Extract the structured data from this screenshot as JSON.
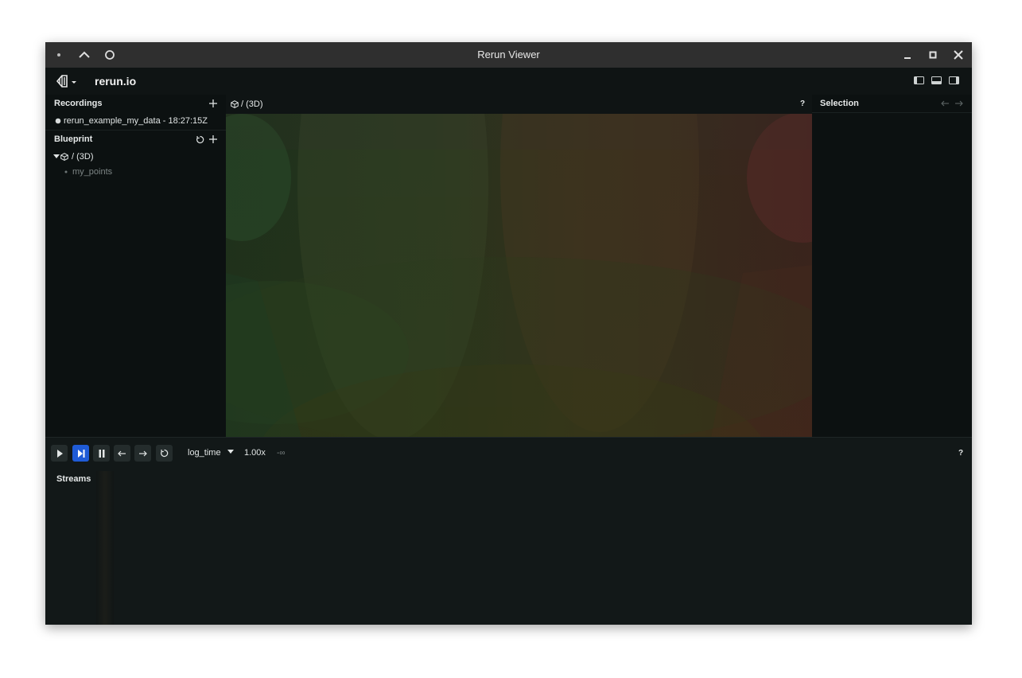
{
  "window": {
    "title": "Rerun Viewer",
    "controls": [
      "minimize-icon",
      "maximize-icon",
      "close-icon"
    ],
    "left_controls": [
      "dot-icon",
      "chevron-up-icon",
      "circle-icon"
    ]
  },
  "appbar": {
    "brand": "rerun.io",
    "logo_icon": "rerun-logo-icon",
    "layout_buttons": [
      "toggle-left-panel-icon",
      "toggle-bottom-panel-icon",
      "toggle-right-panel-icon"
    ]
  },
  "recordings": {
    "title": "Recordings",
    "add_icon": "plus-icon",
    "items": [
      {
        "label": "rerun_example_my_data - 18:27:15Z"
      }
    ]
  },
  "blueprint": {
    "title": "Blueprint",
    "reset_icon": "reset-icon",
    "add_icon": "plus-icon",
    "tree": [
      {
        "label": "/ (3D)",
        "expanded": true,
        "icon": "cube-icon",
        "children": [
          {
            "label": "my_points"
          }
        ]
      }
    ]
  },
  "view": {
    "title": "/ (3D)",
    "help": "?",
    "icon": "cube-icon"
  },
  "selection": {
    "title": "Selection",
    "nav": [
      "arrow-left-icon",
      "arrow-right-icon"
    ]
  },
  "timeline": {
    "controls": [
      "play-icon",
      "step-forward-icon",
      "pause-icon",
      "arrow-left-icon",
      "arrow-right-icon",
      "loop-icon"
    ],
    "active_control": "step-forward-icon",
    "timeline_name": "log_time",
    "speed": "1.00x",
    "current_time": "-∞",
    "help": "?",
    "streams_label": "Streams"
  },
  "colors": {
    "accent": "#1f5bd6",
    "background": "#0c1111",
    "panel": "#121818",
    "titlebar": "#2f2f2f"
  }
}
